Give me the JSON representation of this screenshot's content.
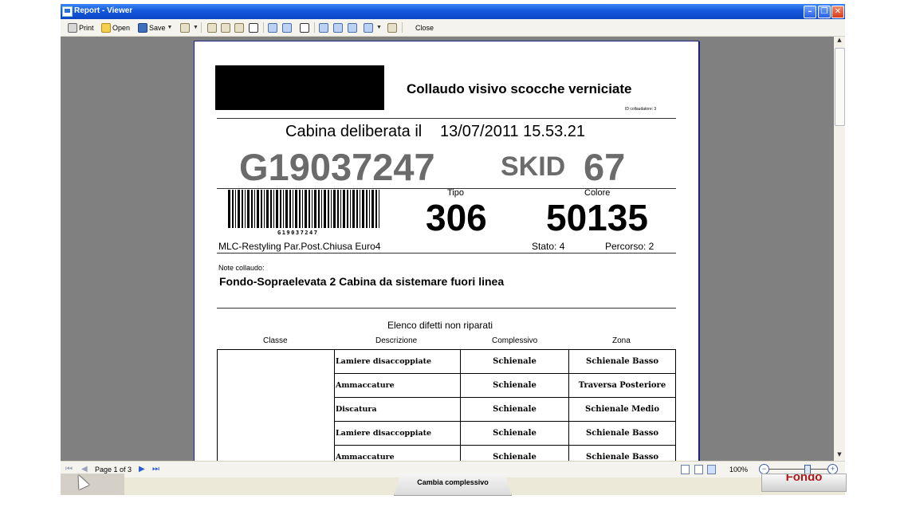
{
  "window": {
    "title": "Report - Viewer"
  },
  "toolbar": {
    "print": "Print",
    "open": "Open",
    "save": "Save",
    "close": "Close"
  },
  "report": {
    "title": "Collaudo visivo scocche verniciate",
    "inspector_id": "ID collaudatore:  3",
    "deliberata_label": "Cabina deliberata il",
    "deliberata_datetime": "13/07/2011 15.53.21",
    "vin": "G19037247",
    "skid_label": "SKID",
    "skid_number": "67",
    "barcode_text": "G19037247",
    "tipo_label": "Tipo",
    "tipo_value": "306",
    "colore_label": "Colore",
    "colore_value": "50135",
    "model": "MLC-Restyling Par.Post.Chiusa Euro4",
    "stato": "Stato:  4",
    "percorso": "Percorso:  2",
    "note_label": "Note collaudo:",
    "note_text": "Fondo-Sopraelevata 2   Cabina da sistemare fuori linea",
    "list_title": "Elenco difetti non riparati",
    "columns": [
      "Classe",
      "Descrizione",
      "Complessivo",
      "Zona"
    ],
    "rows": [
      [
        "Lamiere disaccoppiate",
        "Schienale",
        "Schienale Basso"
      ],
      [
        "Ammaccature",
        "Schienale",
        "Traversa Posteriore"
      ],
      [
        "Discatura",
        "Schienale",
        "Schienale Medio"
      ],
      [
        "Lamiere disaccoppiate",
        "Schienale",
        "Schienale Basso"
      ],
      [
        "Ammaccature",
        "Schienale",
        "Schienale Basso"
      ]
    ]
  },
  "nav": {
    "page": "Page 1 of 3",
    "zoom": "100%",
    "zoom_level": 0.6
  },
  "below": {
    "tab_label": "Cambia complessivo",
    "right_button": "Fondo"
  }
}
